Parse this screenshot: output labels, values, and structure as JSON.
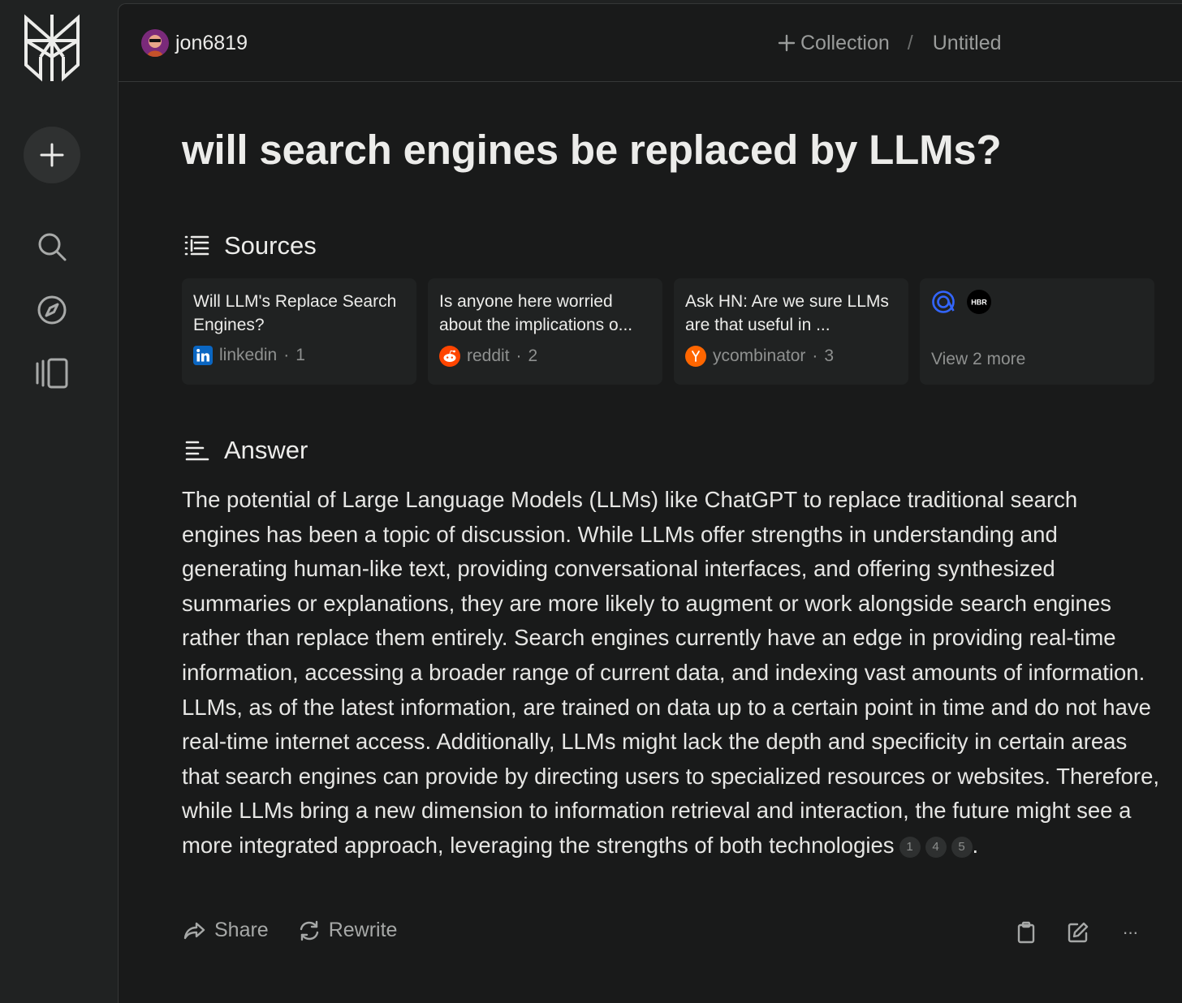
{
  "header": {
    "username": "jon6819",
    "collection_label": "Collection",
    "separator": "/",
    "title": "Untitled"
  },
  "query": "will search engines be replaced by LLMs?",
  "sources": {
    "heading": "Sources",
    "cards": [
      {
        "title": "Will LLM's Replace Search Engines?",
        "site": "linkedin",
        "index": "1",
        "icon": "linkedin-icon"
      },
      {
        "title": "Is anyone here worried about the implications o...",
        "site": "reddit",
        "index": "2",
        "icon": "reddit-icon"
      },
      {
        "title": "Ask HN: Are we sure LLMs are that useful in ...",
        "site": "ycombinator",
        "index": "3",
        "icon": "ycombinator-icon"
      }
    ],
    "more_icons": [
      "circle-logo-icon",
      "hbr-icon"
    ],
    "more_icon_text": "HBR",
    "view_more": "View 2 more"
  },
  "answer": {
    "heading": "Answer",
    "text": "The potential of Large Language Models (LLMs) like ChatGPT to replace traditional search engines has been a topic of discussion. While LLMs offer strengths in understanding and generating human-like text, providing conversational interfaces, and offering synthesized summaries or explanations, they are more likely to augment or work alongside search engines rather than replace them entirely. Search engines currently have an edge in providing real-time information, accessing a broader range of current data, and indexing vast amounts of information. LLMs, as of the latest information, are trained on data up to a certain point in time and do not have real-time internet access. Additionally, LLMs might lack the depth and specificity in certain areas that search engines can provide by directing users to specialized resources or websites. Therefore, while LLMs bring a new dimension to information retrieval and interaction, the future might see a more integrated approach, leveraging the strengths of both technologies",
    "citations": [
      "1",
      "4",
      "5"
    ],
    "end_punct": "."
  },
  "actions": {
    "share": "Share",
    "rewrite": "Rewrite",
    "more": "···"
  },
  "colors": {
    "sidebar_bg": "#202222",
    "main_bg": "#191a1a",
    "card_bg": "#202222",
    "text": "#ececea",
    "muted": "#8f9190",
    "linkedin": "#0a66c2",
    "reddit": "#ff4500",
    "ycombinator": "#ff6600"
  }
}
